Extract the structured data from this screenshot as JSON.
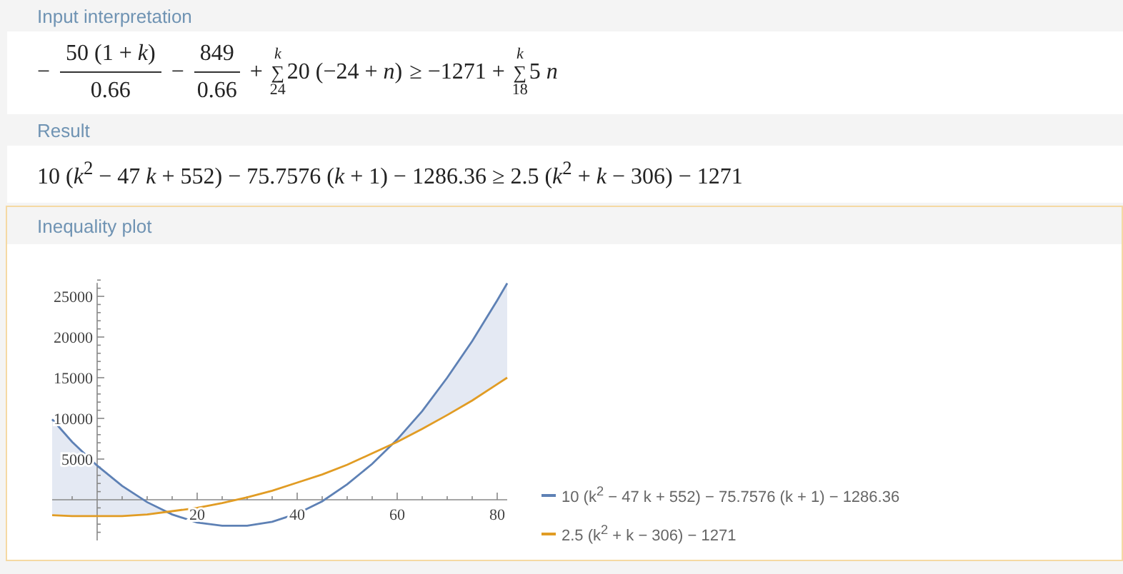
{
  "pods": [
    {
      "title": "Input interpretation",
      "kind": "input",
      "terms": [
        {
          "kind": "op",
          "text": "−"
        },
        {
          "kind": "fraction",
          "numerator": "50 (1 + *k*)",
          "denominator": "0.66"
        },
        {
          "kind": "op",
          "text": "−"
        },
        {
          "kind": "fraction",
          "numerator": "849",
          "denominator": "0.66"
        },
        {
          "kind": "op",
          "text": "+"
        },
        {
          "kind": "sum",
          "upper": "k",
          "symbol": "∑",
          "lower": "24",
          "body": "20 (−24 + *n*)"
        },
        {
          "kind": "op",
          "text": "≥ −1271 +"
        },
        {
          "kind": "sum",
          "upper": "k",
          "symbol": "∑",
          "lower": "18",
          "body": "5 *n*"
        }
      ]
    },
    {
      "title": "Result",
      "kind": "result",
      "text": "10 (*k*$^{2}$ − 47 *k* + 552) − 75.7576 (*k* + 1) − 1286.36 ≥ 2.5 (*k*$^{2}$ + *k* − 306) − 1271"
    },
    {
      "title": "Inequality plot",
      "kind": "plot",
      "chart_data": {
        "type": "line",
        "x": [
          -9,
          -5,
          0,
          5,
          10,
          15,
          20,
          25,
          30,
          35,
          40,
          45,
          50,
          55,
          60,
          65,
          70,
          75,
          80,
          82
        ],
        "series": [
          {
            "name": "10 (k$^{2}$ − 47 k + 552) − 75.7576 (k + 1) − 1286.36",
            "color": "#5e81b5",
            "values": [
              9900,
              7100,
              4200,
              1700,
              -300,
              -1800,
              -2800,
              -3200,
              -3200,
              -2700,
              -1700,
              -200,
              1900,
              4400,
              7400,
              10900,
              15000,
              19500,
              24500,
              26600
            ]
          },
          {
            "name": "2.5 (k$^{2}$ + k − 306) − 1271",
            "color": "#e19c24",
            "values": [
              -1900,
              -2000,
              -2000,
              -2000,
              -1800,
              -1400,
              -1000,
              -400,
              300,
              1100,
              2100,
              3100,
              4300,
              5700,
              7100,
              8700,
              10400,
              12200,
              14200,
              15000
            ]
          }
        ],
        "xlim": [
          -9,
          82
        ],
        "ylim": [
          -5000,
          27000
        ],
        "xticks": [
          20,
          40,
          60,
          80
        ],
        "yticks": [
          5000,
          10000,
          15000,
          20000,
          25000
        ]
      }
    }
  ]
}
